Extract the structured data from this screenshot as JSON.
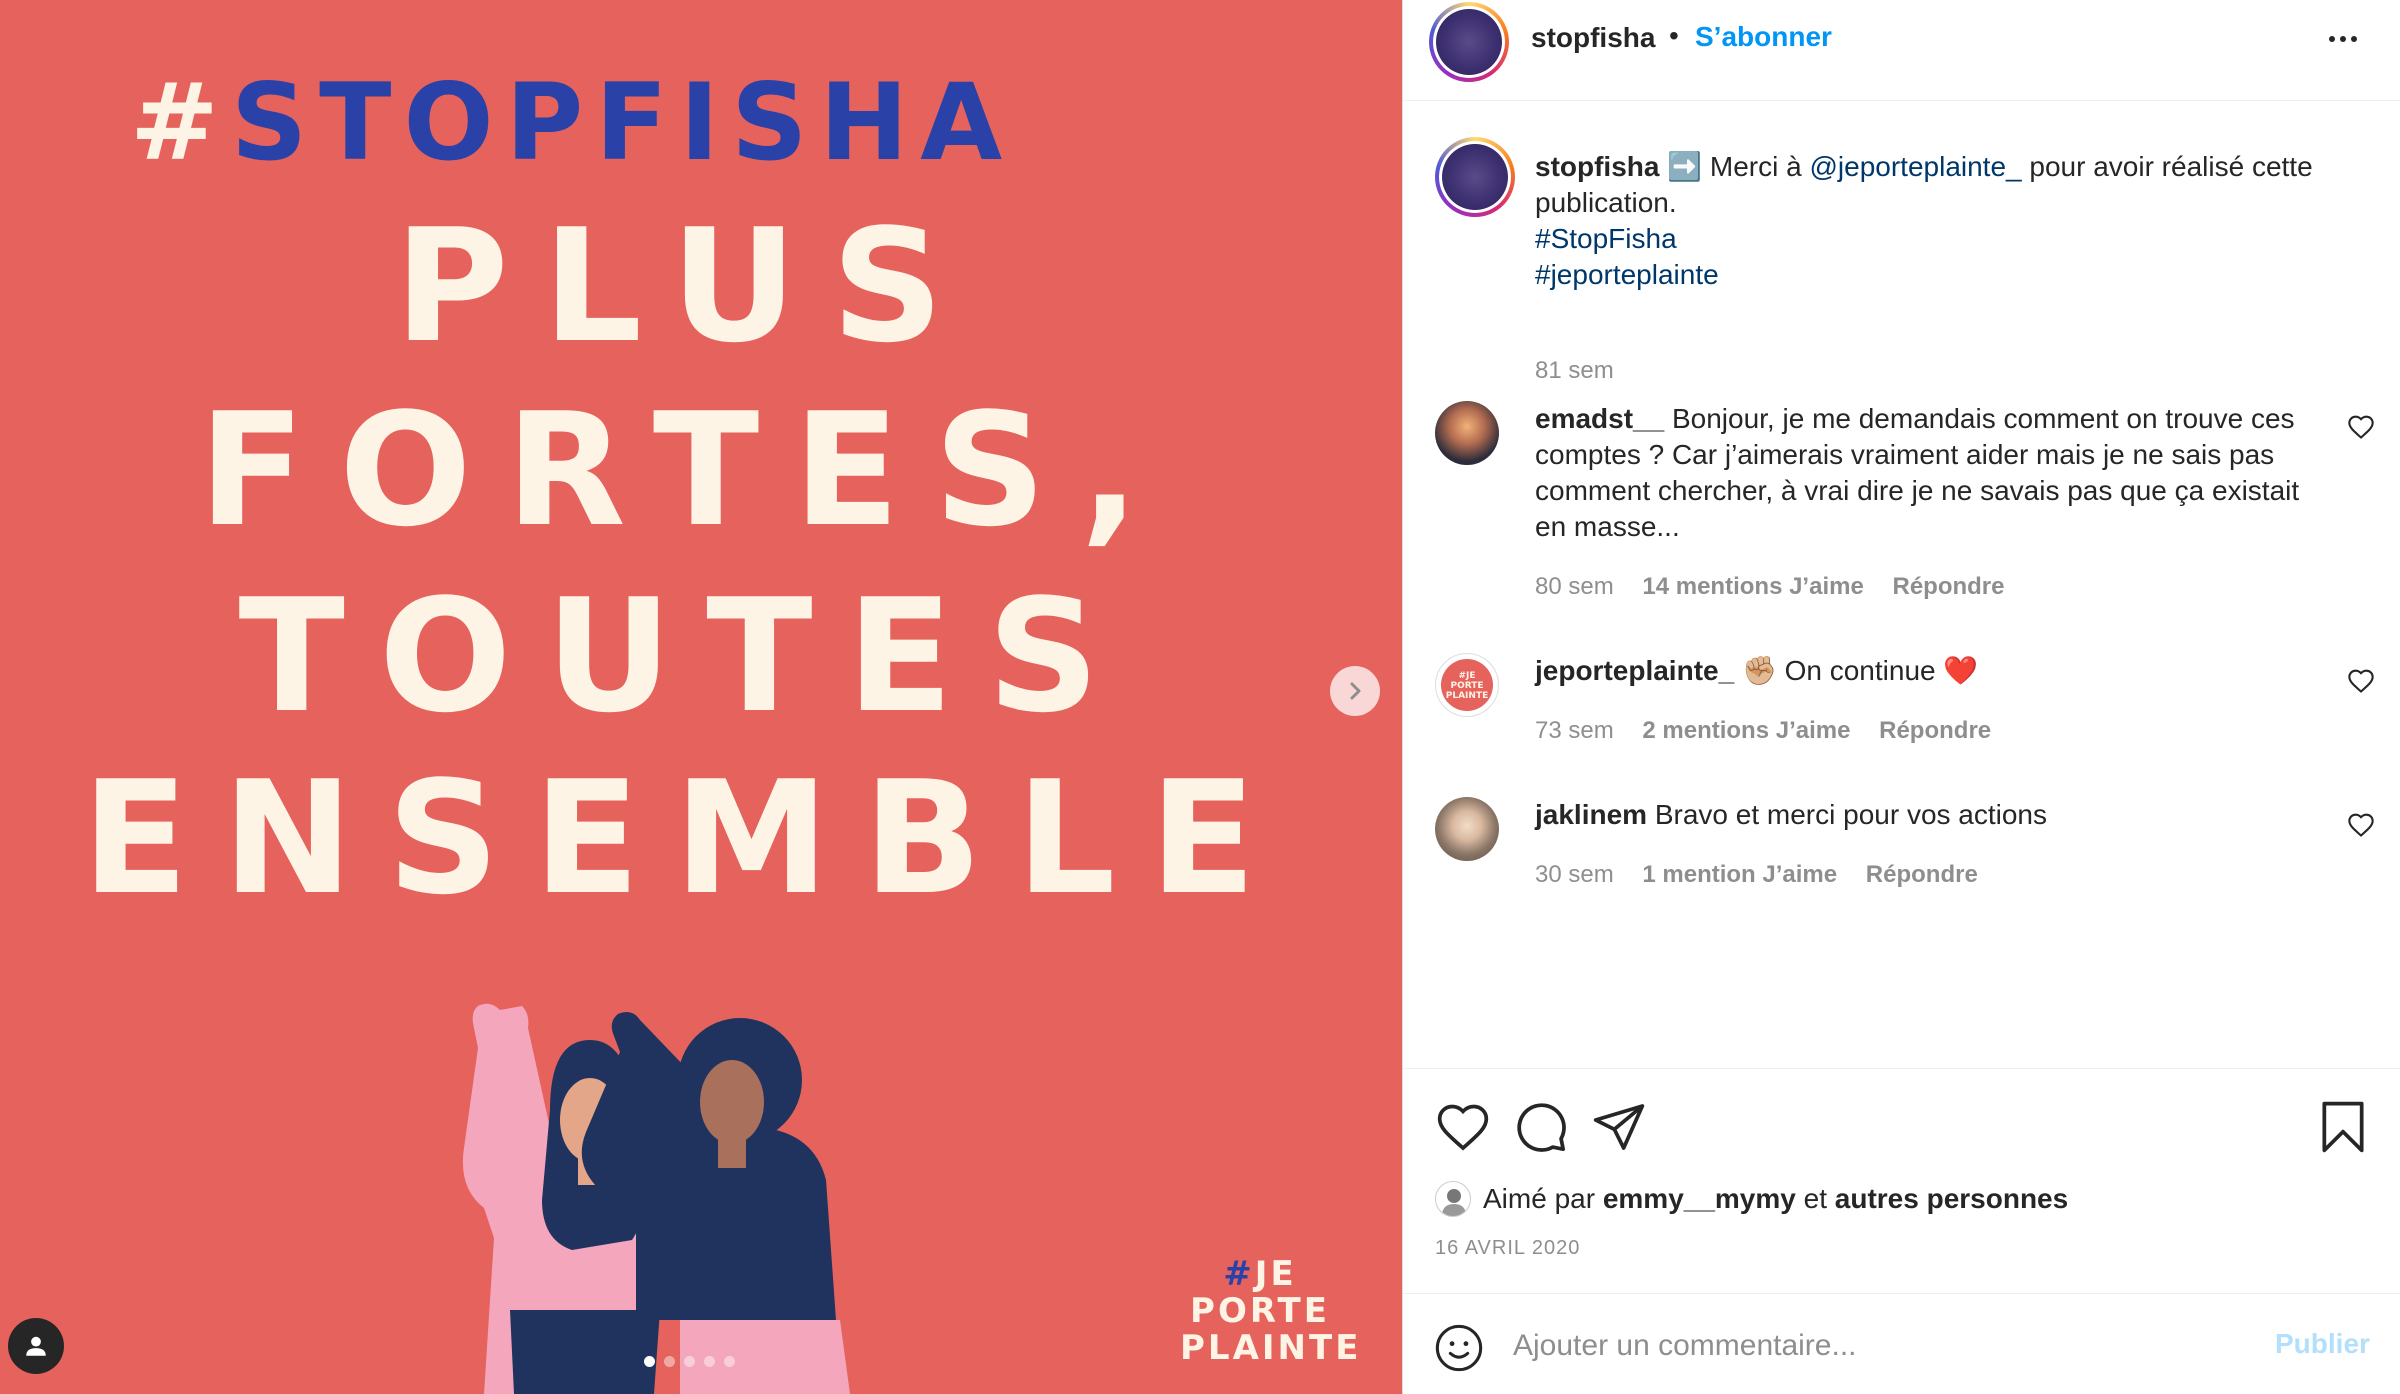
{
  "post_image": {
    "hashtag_symbol": "#",
    "hashtag_word": "STOPFISHA",
    "lines": [
      "PLUS",
      "FORTES,",
      "TOUTES",
      "ENSEMBLE"
    ],
    "stamp": {
      "hash": "#",
      "line1": "JE",
      "line2": "PORTE",
      "line3": "PLAINTE"
    },
    "carousel": {
      "total": 5,
      "active": 1
    }
  },
  "header": {
    "username": "stopfisha",
    "separator": "•",
    "follow_label": "S’abonner"
  },
  "caption": {
    "username": "stopfisha",
    "emoji": "➡️",
    "text_before": " Merci à ",
    "mention": "@jeporteplainte_",
    "text_after": " pour avoir réalisé cette publication.",
    "hashtag1": "#StopFisha",
    "hashtag2": "#jeporteplainte",
    "time": "81 sem"
  },
  "comments": [
    {
      "username": "emadst__",
      "text": " Bonjour, je me demandais comment on trouve ces comptes ? Car j’aimerais vraiment aider mais je ne sais pas comment chercher, à vrai dire je ne savais pas que ça existait en masse...",
      "time": "80 sem",
      "likes": "14 mentions J’aime",
      "reply": "Répondre"
    },
    {
      "username": "jeporteplainte_",
      "text": " ✊🏼 On continue ❤️",
      "time": "73 sem",
      "likes": "2 mentions J’aime",
      "reply": "Répondre",
      "avatar_text": "#JE PORTE PLAINTE"
    },
    {
      "username": "jaklinem",
      "text": " Bravo et merci pour vos actions",
      "time": "30 sem",
      "likes": "1 mention J’aime",
      "reply": "Répondre"
    }
  ],
  "likes": {
    "prefix": "Aimé par ",
    "user": "emmy__mymy",
    "middle": " et ",
    "others": "autres personnes"
  },
  "date": "16 AVRIL 2020",
  "comment_box": {
    "placeholder": "Ajouter un commentaire...",
    "publish_label": "Publier"
  },
  "colors": {
    "post_background": "#e6625c",
    "accent_blue": "#2a42a8",
    "cream": "#fdf4e6",
    "link_blue": "#0095f6"
  }
}
